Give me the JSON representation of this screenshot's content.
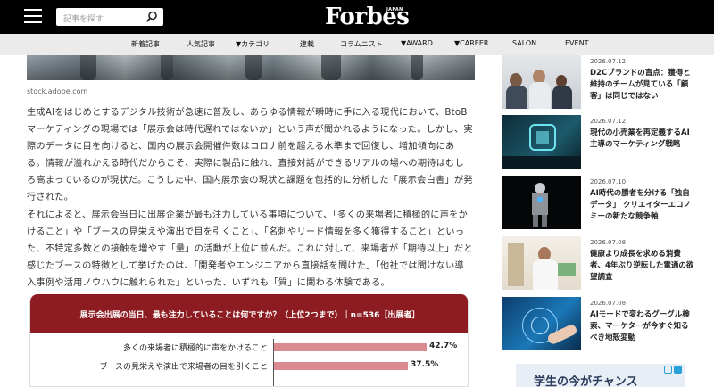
{
  "header": {
    "search_placeholder": "記事を探す",
    "logo": "Forbes",
    "logo_sub": "JAPAN"
  },
  "nav": {
    "items": [
      "新着記事",
      "人気記事",
      "▼カテゴリ",
      "連載",
      "コラムニスト",
      "▼AWARD",
      "▼CAREER",
      "SALON",
      "EVENT"
    ]
  },
  "article": {
    "photo_credit": "stock.adobe.com",
    "paragraph1": "生成AIをはじめとするデジタル技術が急速に普及し、あらゆる情報が瞬時に手に入る現代において、BtoBマーケティングの現場では「展示会は時代遅れではないか」という声が聞かれるようになった。しかし、実際のデータに目を向けると、国内の展示会開催件数はコロナ前を超える水準まで回復し、増加傾向にある。情報が溢れかえる時代だからこそ、実際に製品に触れ、直接対話ができるリアルの場への期待はむしろ高まっているのが現状だ。こうした中、国内展示会の現状と課題を包括的に分析した「展示会白書」が発行された。",
    "paragraph2": "それによると、展示会当日に出展企業が最も注力している事項について、「多くの来場者に積極的に声をかけること」や「ブースの見栄えや演出で目を引くこと」、「名刺やリード情報を多く獲得すること」といった、不特定多数との接触を増やす「量」の活動が上位に並んだ。これに対して、来場者が「期待以上」だと感じたブースの特徴として挙げたのは、「開発者やエンジニアから直接話を聞けた」「他社では聞けない導入事例や活用ノウハウに触れられた」といった、いずれも「質」に関わる体験である。"
  },
  "chart_data": {
    "type": "bar",
    "orientation": "horizontal",
    "title": "展示会出展の当日、最も注力していることは何ですか？（上位2つまで）｜n=536［出展者］",
    "categories": [
      "多くの来場者に積極的に声をかけること",
      "ブースの見栄えや演出で来場者の目を引くこと"
    ],
    "values": [
      42.7,
      37.5
    ],
    "value_labels": [
      "42.7%",
      "37.5%"
    ],
    "colors": {
      "header": "#8c1c21",
      "bar": "#d98b90"
    }
  },
  "sidebar": {
    "items": [
      {
        "date": "2026.07.12",
        "title": "D2Cブランドの盲点：獲得と維持のチームが見ている「顧客」は同じではない"
      },
      {
        "date": "2026.07.12",
        "title": "現代の小売業を再定義するAI主導のマーケティング戦略"
      },
      {
        "date": "2026.07.10",
        "title": "AI時代の勝者を分ける「独自データ」 クリエイターエコノミーの新たな競争軸"
      },
      {
        "date": "2026.07.08",
        "title": "健康より成長を求める消費者、4年ぶり逆転した電通の欲望調査"
      },
      {
        "date": "2026.07.08",
        "title": "AIモードで変わるグーグル検索、マーケターが今すぐ知るべき地殻変動"
      }
    ]
  },
  "ad": {
    "text": "学生の今がチャンス"
  }
}
